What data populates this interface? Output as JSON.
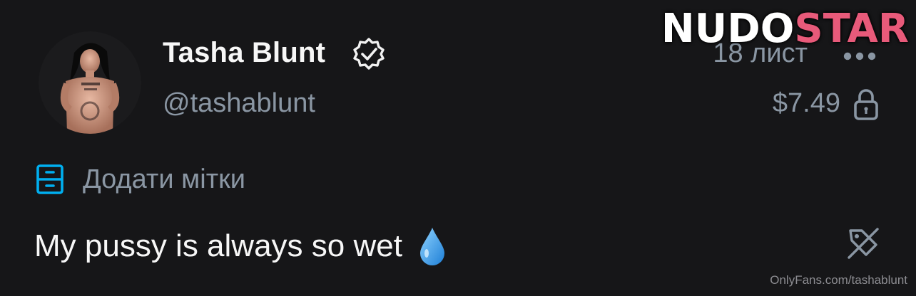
{
  "profile": {
    "display_name": "Tasha Blunt",
    "username": "@tashablunt",
    "avatar_icon": "profile-photo",
    "verified_icon": "verified-badge-icon"
  },
  "post_meta": {
    "date": "18 лист",
    "price": "$7.49",
    "more_icon": "more-dots-icon",
    "lock_icon": "lock-icon"
  },
  "tags": {
    "label": "Додати мітки",
    "icon": "tag-drawer-icon"
  },
  "post": {
    "text": "My pussy is always so wet",
    "emoji_icon": "droplet-icon",
    "hide_icon": "tag-off-icon"
  },
  "watermark": {
    "logo_part1": "NUDO",
    "logo_part2": "STAR",
    "url": "OnlyFans.com/tashablunt"
  },
  "colors": {
    "background": "#161618",
    "muted_text": "#8a96a3",
    "accent_blue": "#00aff0",
    "logo_pink": "#e85a7a"
  }
}
